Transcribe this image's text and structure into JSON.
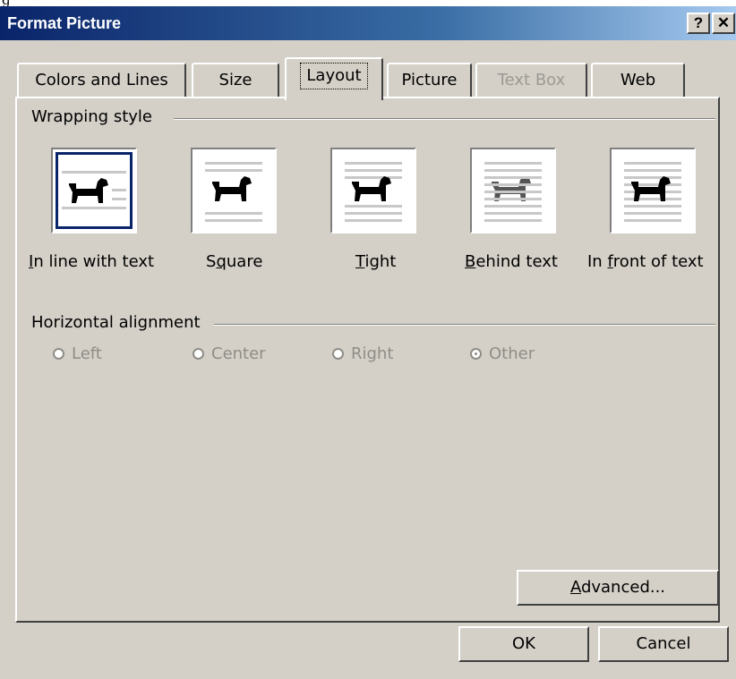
{
  "window": {
    "title": "Format Picture",
    "help_label": "?",
    "close_label": "✕"
  },
  "tabs": [
    {
      "label": "Colors and Lines",
      "state": "normal"
    },
    {
      "label": "Size",
      "state": "normal"
    },
    {
      "label": "Layout",
      "state": "active"
    },
    {
      "label": "Picture",
      "state": "normal"
    },
    {
      "label": "Text Box",
      "state": "disabled"
    },
    {
      "label": "Web",
      "state": "normal"
    }
  ],
  "wrapping": {
    "heading": "Wrapping style",
    "selected": "In line with text",
    "options": [
      {
        "pre": "",
        "key": "I",
        "post": "n line with text",
        "icon": "inline-dog-icon"
      },
      {
        "pre": "S",
        "key": "q",
        "post": "uare",
        "icon": "square-dog-icon"
      },
      {
        "pre": "",
        "key": "T",
        "post": "ight",
        "icon": "tight-dog-icon"
      },
      {
        "pre": "",
        "key": "B",
        "post": "ehind text",
        "icon": "behind-dog-icon"
      },
      {
        "pre": "In ",
        "key": "f",
        "post": "ront of text",
        "icon": "front-dog-icon"
      }
    ]
  },
  "alignment": {
    "heading": "Horizontal alignment",
    "selected": "Other",
    "options": [
      "Left",
      "Center",
      "Right",
      "Other"
    ]
  },
  "buttons": {
    "advanced_pre": "",
    "advanced_key": "A",
    "advanced_post": "dvanced...",
    "ok": "OK",
    "cancel": "Cancel"
  }
}
